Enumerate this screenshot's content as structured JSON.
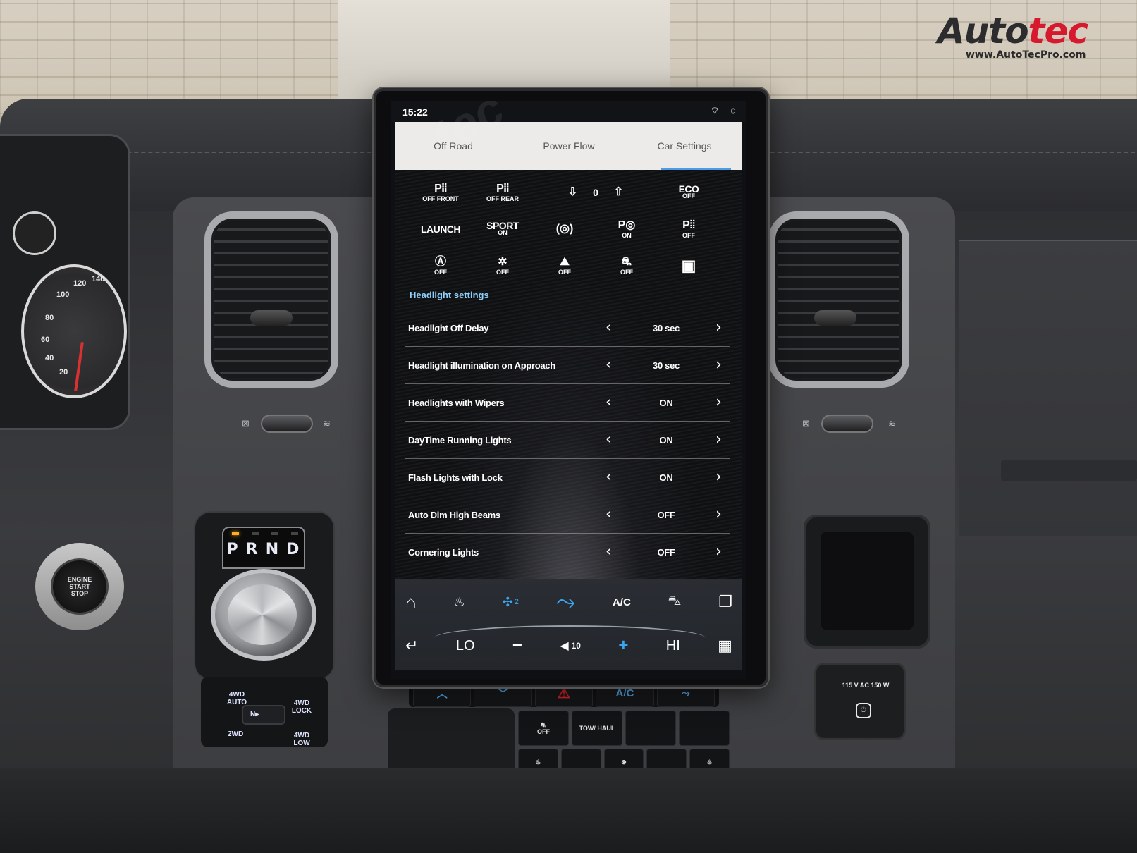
{
  "brand": {
    "logo_auto": "Auto",
    "logo_tec": "tec",
    "url": "www.AutoTecPro.com",
    "accent_color": "#d6192d"
  },
  "status_bar": {
    "time": "15:22",
    "icons": [
      "wifi-icon",
      "brightness-icon"
    ]
  },
  "tabs": [
    {
      "label": "Off Road",
      "active": false
    },
    {
      "label": "Power Flow",
      "active": false
    },
    {
      "label": "Car Settings",
      "active": true
    }
  ],
  "quick_controls": {
    "row1": [
      {
        "name": "park-assist-front-off",
        "glyph": "P⦙⦙",
        "sub": "OFF FRONT"
      },
      {
        "name": "park-assist-rear-off",
        "glyph": "P⦙⦙",
        "sub": "OFF REAR"
      },
      {
        "name": "ride-height",
        "lower_glyph": "⇩",
        "value": "0",
        "raise_glyph": "⇧"
      },
      {
        "name": "eco-off",
        "glyph": "ECO",
        "sub": "OFF"
      }
    ],
    "row2": [
      {
        "name": "launch",
        "glyph": "LAUNCH",
        "sub": ""
      },
      {
        "name": "sport-on",
        "glyph": "SPORT",
        "sub": "ON"
      },
      {
        "name": "parking-brake",
        "glyph": "(◎)",
        "sub": ""
      },
      {
        "name": "park-steering-on",
        "glyph": "P◎",
        "sub": "ON"
      },
      {
        "name": "park-assist-off",
        "glyph": "P⦙⦙",
        "sub": "OFF"
      }
    ],
    "row3": [
      {
        "name": "auto-stop-off",
        "glyph": "Ⓐ",
        "sub": "OFF"
      },
      {
        "name": "collision-warning-off",
        "glyph": "✲",
        "sub": "OFF"
      },
      {
        "name": "hill-descent-off",
        "glyph": "⛰",
        "sub": "OFF"
      },
      {
        "name": "traction-control-off",
        "glyph": "⛐",
        "sub": "OFF"
      },
      {
        "name": "display-settings",
        "glyph": "▣",
        "sub": ""
      }
    ]
  },
  "headlight_settings": {
    "title": "Headlight settings",
    "rows": [
      {
        "label": "Headlight Off Delay",
        "value": "30 sec"
      },
      {
        "label": "Headlight illumination on Approach",
        "value": "30 sec"
      },
      {
        "label": "Headlights with Wipers",
        "value": "ON"
      },
      {
        "label": "DayTime Running Lights",
        "value": "ON"
      },
      {
        "label": "Flash Lights with Lock",
        "value": "ON"
      },
      {
        "label": "Auto Dim High Beams",
        "value": "OFF"
      },
      {
        "label": "Cornering Lights",
        "value": "OFF"
      }
    ],
    "prev_glyph": "‹",
    "next_glyph": "›"
  },
  "climate_dock": {
    "home_glyph": "⌂",
    "defrost_glyph": "♨",
    "fan_glyph": "✣",
    "fan_speed": "2",
    "seat_glyph": "⤳",
    "ac_label": "A/C",
    "recirc_glyph": "⛍",
    "multitask_glyph": "❐",
    "back_glyph": "↵",
    "temp_low": "LO",
    "minus": "−",
    "volume_glyph": "◀",
    "volume": "10",
    "plus": "+",
    "temp_high": "HI",
    "apps_glyph": "▦",
    "accent_color": "#3aa6f0"
  },
  "physical_controls": {
    "gears": [
      "P",
      "R",
      "N",
      "D"
    ],
    "selected_gear": "P",
    "drive_modes": {
      "auto": "4WD AUTO",
      "lock": "4WD LOCK",
      "two": "2WD",
      "low": "4WD LOW",
      "neutral": "N▸"
    },
    "engine_button": [
      "ENGINE",
      "START",
      "STOP"
    ],
    "switch_row": [
      {
        "name": "scroll-up",
        "label": "︿"
      },
      {
        "name": "scroll-down",
        "label": "﹀"
      },
      {
        "name": "hazard",
        "label": "⚠"
      },
      {
        "name": "ac",
        "label": "A/C"
      },
      {
        "name": "seat-airflow",
        "label": "⤳"
      }
    ],
    "traction_off": "OFF",
    "tow_haul": "TOW/ HAUL",
    "outlet_label": "115 V AC 150 W",
    "outlet_glyph": "⏻",
    "gauge_ticks": [
      "120",
      "140",
      "100",
      "80",
      "60",
      "40",
      "20"
    ]
  }
}
